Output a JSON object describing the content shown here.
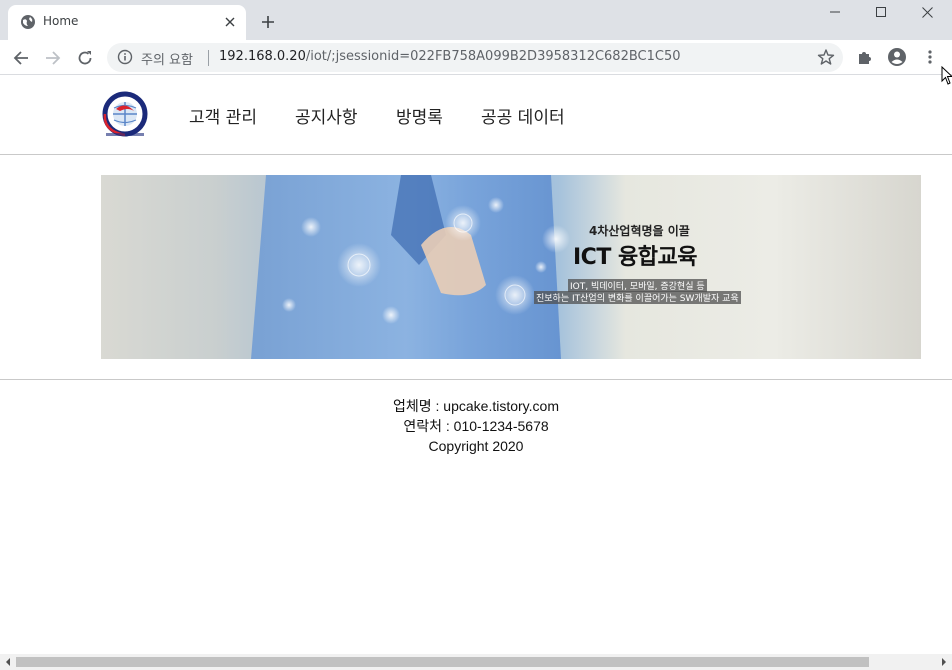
{
  "browser": {
    "tab": {
      "title": "Home",
      "favicon": "globe-icon",
      "close_icon": "close-icon"
    },
    "new_tab_icon": "plus-icon",
    "window_controls": [
      "minimize-icon",
      "maximize-icon",
      "close-icon"
    ],
    "nav": [
      "back-icon",
      "forward-icon",
      "reload-icon"
    ],
    "omnibox": {
      "security_text": "주의 요함",
      "url_host": "192.168.0.20",
      "url_path": "/iot/;jsessionid=022FB758A099B2D3958312C682BC1C50"
    },
    "toolbar_icons": [
      "bookmark-star-icon",
      "extensions-icon",
      "profile-icon",
      "menu-icon"
    ]
  },
  "site": {
    "nav": [
      "고객 관리",
      "공지사항",
      "방명록",
      "공공 데이터"
    ],
    "banner": {
      "kicker": "4차산업혁명을 이끌",
      "title": "ICT 융합교육",
      "sub1": "IOT, 빅데이터, 모바일, 증강현실 등",
      "sub2": "진보하는 IT산업의 변화를 이끌어가는 SW개발자 교육"
    },
    "footer": {
      "company": "업체명 : upcake.tistory.com",
      "contact": "연락처 : 010-1234-5678",
      "copyright": "Copyright 2020"
    }
  },
  "colors": {
    "chrome_bg": "#dee1e6",
    "omnibox_bg": "#f1f3f4",
    "logo_navy": "#1b2a7a",
    "logo_red": "#d9232e"
  }
}
